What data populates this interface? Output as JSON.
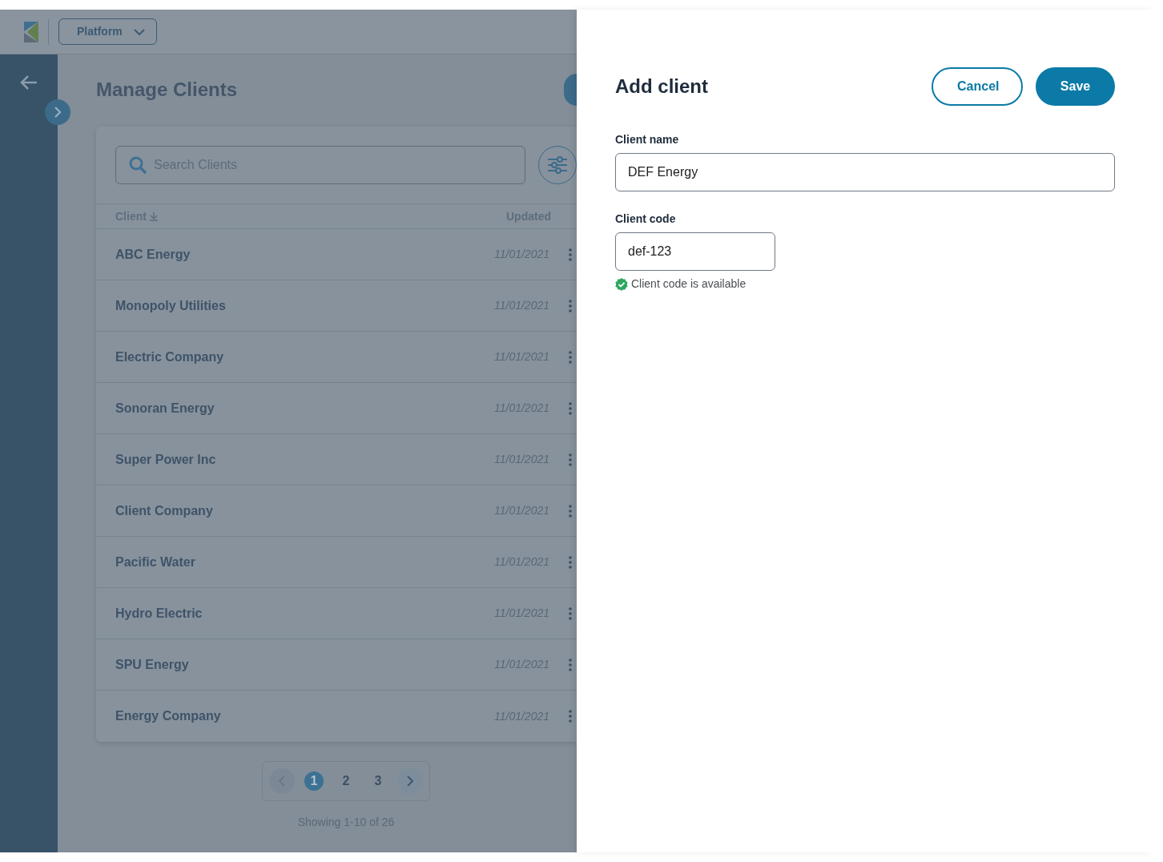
{
  "topbar": {
    "platform_menu": "Platform"
  },
  "page": {
    "title": "Manage Clients"
  },
  "search": {
    "placeholder": "Search Clients"
  },
  "table": {
    "columns": [
      "Client",
      "Updated"
    ],
    "rows": [
      {
        "name": "ABC Energy",
        "updated": "11/01/2021"
      },
      {
        "name": "Monopoly Utilities",
        "updated": "11/01/2021"
      },
      {
        "name": "Electric Company",
        "updated": "11/01/2021"
      },
      {
        "name": "Sonoran Energy",
        "updated": "11/01/2021"
      },
      {
        "name": "Super Power Inc",
        "updated": "11/01/2021"
      },
      {
        "name": "Client Company",
        "updated": "11/01/2021"
      },
      {
        "name": "Pacific Water",
        "updated": "11/01/2021"
      },
      {
        "name": "Hydro Electric",
        "updated": "11/01/2021"
      },
      {
        "name": "SPU Energy",
        "updated": "11/01/2021"
      },
      {
        "name": "Energy Company",
        "updated": "11/01/2021"
      }
    ]
  },
  "pagination": {
    "pages": [
      {
        "label": "1",
        "selected": true
      },
      {
        "label": "2",
        "selected": false
      },
      {
        "label": "3",
        "selected": false
      }
    ],
    "summary": "Showing 1-10 of 26"
  },
  "drawer": {
    "title": "Add client",
    "buttons": [
      {
        "label": "Cancel",
        "kind": "outline"
      },
      {
        "label": "Save",
        "kind": "primary"
      }
    ],
    "fields": [
      {
        "label": "Client name",
        "value": "DEF Energy"
      },
      {
        "label": "Client code",
        "value": "def-123"
      }
    ],
    "validation": "Client code is available"
  }
}
